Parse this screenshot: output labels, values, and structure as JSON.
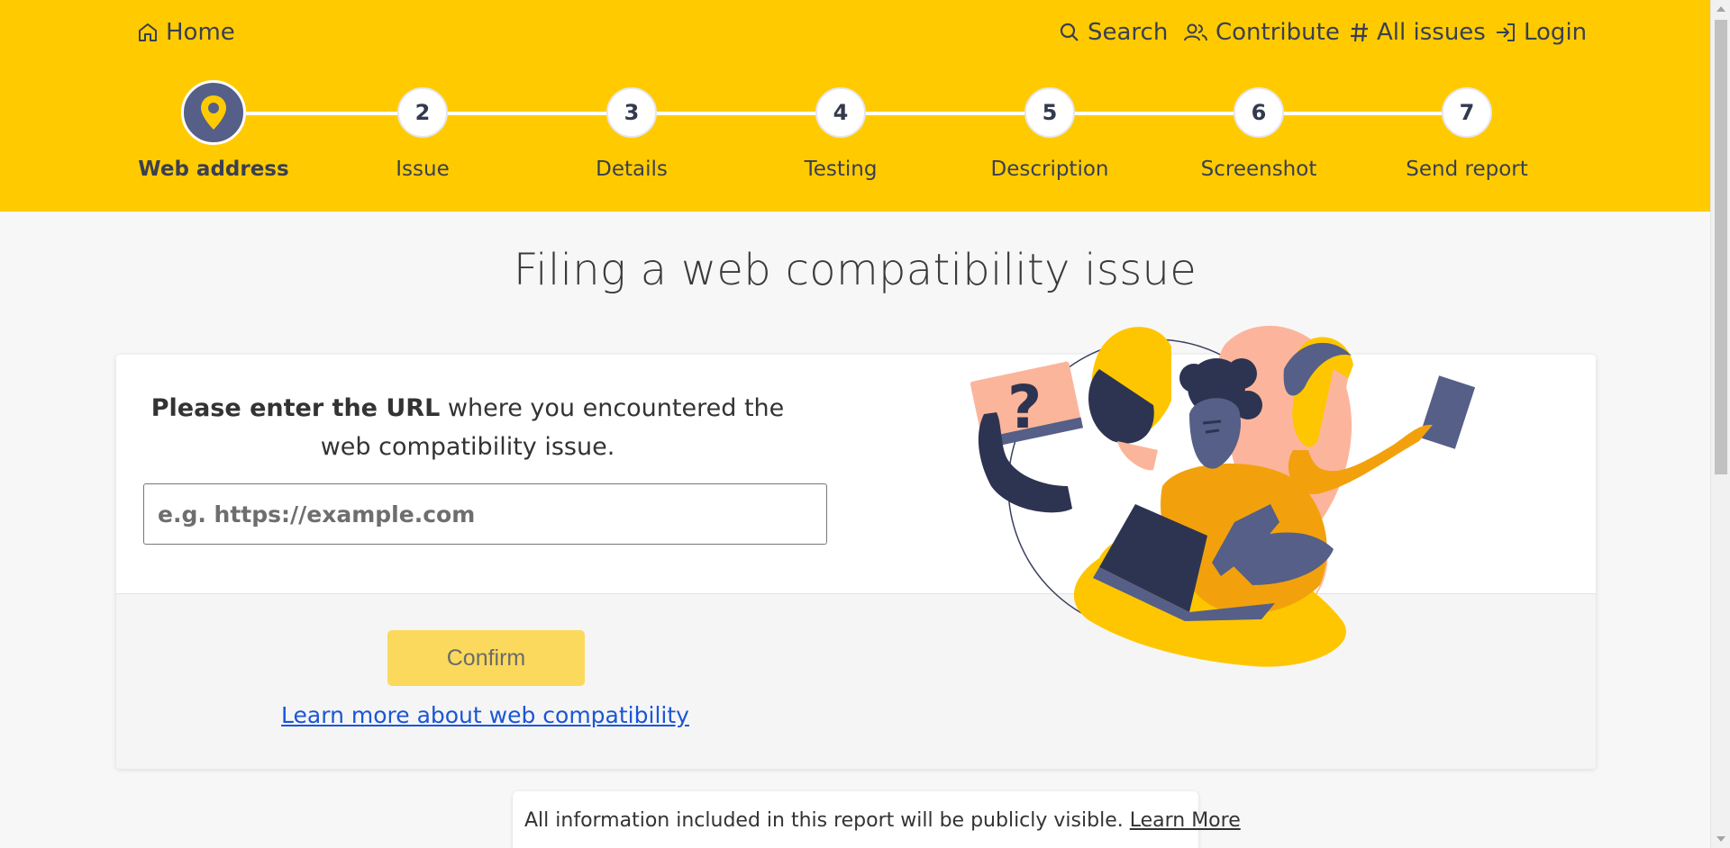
{
  "nav": {
    "home": "Home",
    "search": "Search",
    "contribute": "Contribute",
    "all_issues": "All issues",
    "login": "Login"
  },
  "steps": [
    {
      "number": "1",
      "label": "Web address",
      "active": true,
      "icon": "location-pin-icon"
    },
    {
      "number": "2",
      "label": "Issue"
    },
    {
      "number": "3",
      "label": "Details"
    },
    {
      "number": "4",
      "label": "Testing"
    },
    {
      "number": "5",
      "label": "Description"
    },
    {
      "number": "6",
      "label": "Screenshot"
    },
    {
      "number": "7",
      "label": "Send report"
    }
  ],
  "main": {
    "title": "Filing a web compatibility issue",
    "prompt_bold": "Please enter the URL",
    "prompt_rest": " where you encountered the web compatibility issue.",
    "url_placeholder": "e.g. https://example.com",
    "url_value": "",
    "confirm_label": "Confirm",
    "learn_more_link": "Learn more about web compatibility"
  },
  "notice": {
    "text": "All information included in this report will be publicly visible.",
    "link": "Learn More"
  },
  "colors": {
    "header_bg": "#ffcb00",
    "step_active": "#555f87",
    "confirm_bg": "#fbd95c",
    "link": "#1a56d6"
  }
}
